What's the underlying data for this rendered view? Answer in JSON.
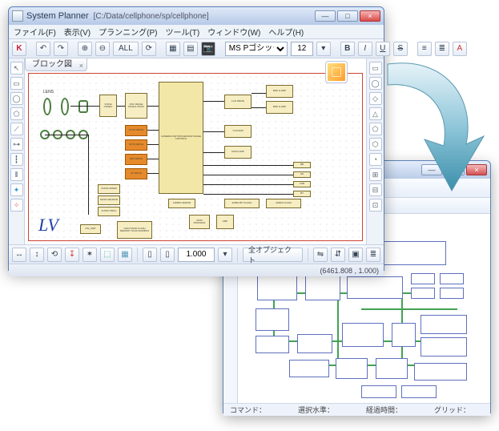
{
  "front_window": {
    "app": "System Planner",
    "path": "[C:/Data/cellphone/sp/cellphone]",
    "menus": [
      "ファイル(F)",
      "表示(V)",
      "プランニング(P)",
      "ツール(T)",
      "ウィンドウ(W)",
      "ヘルプ(H)"
    ],
    "winbtns": {
      "min": "—",
      "max": "□",
      "close": "×"
    },
    "font_name": "MS Pゴシック",
    "font_size": "12",
    "all_label": "ALL",
    "tab_title": "ブロック図",
    "zoom_value": "1.000",
    "zoom_obj_label": "全オブジェクト",
    "status_text": "(6461.808 , 1.000)",
    "brand": "LV",
    "fmt": {
      "bold": "B",
      "italic": "I",
      "under": "U",
      "strike": "S"
    },
    "diagram": {
      "lens_label": "LENS",
      "center": "CAMERA DSP\nPROCESSOR\nIMAGE CONTROL",
      "voice": "VOICE\nCODEC",
      "dsc_proc": "DSC IMAGE\nSIGNAL PROC",
      "lcd": "LCD DRIVE",
      "midi": "MIDI & AMP",
      "yuvamp": "YUV/AMP",
      "massamp": "MASS AMP",
      "cctr": "CCTR\nDRIVE",
      "sutr": "SUTR\nDRIVE",
      "iris": "IRIS\nDRIVE",
      "af": "AF\nDRIVE",
      "zoom": "ZOOM\nDRIVE",
      "sutr2": "SUTR\nDRIVE",
      "voice2": "VOICE\nMIXER",
      "mass": "MASS\nSENSOR",
      "audio": "AUDIO\nPROC",
      "bb": "BB",
      "sd": "SD",
      "usb": "USB",
      "bt": "BT",
      "eth": "BT",
      "flash1": "32Mbit BIT FLASH",
      "flash2": "32Mbit FLASH",
      "sdram": "128Mbit\nSDRAM",
      "romp": "ROM\nPROCESS",
      "amp": "AMP",
      "group": "1Gbit NAND\nFLASH MEMORY\nSCAN RAMBUS",
      "pwamp": "PW_AMP"
    }
  },
  "back_window": {
    "app": "",
    "winbtns": {
      "min": "—",
      "max": "□",
      "close": "×"
    },
    "status_labels": {
      "cmd": "コマンド：",
      "sel": "選択水準：",
      "time": "経過時間：",
      "grid": "グリッド："
    }
  }
}
